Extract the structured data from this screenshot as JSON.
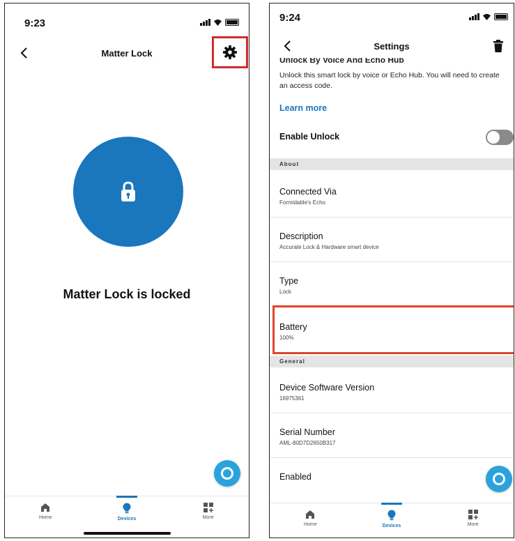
{
  "left": {
    "status_time": "9:23",
    "title": "Matter Lock",
    "lock_status": "Matter Lock is locked",
    "nav": [
      {
        "label": "Home",
        "icon": "home-icon"
      },
      {
        "label": "Devices",
        "icon": "devices-icon",
        "active": true
      },
      {
        "label": "More",
        "icon": "more-icon"
      }
    ]
  },
  "right": {
    "status_time": "9:24",
    "title": "Settings",
    "cut_heading": "Unlock By Voice And Echo Hub",
    "description": "Unlock this smart lock by voice or Echo Hub. You will need to create an access code.",
    "learn_more": "Learn more",
    "enable_unlock_label": "Enable Unlock",
    "enable_unlock_on": false,
    "sections": {
      "about": "About",
      "general": "General"
    },
    "rows": {
      "connected_via": {
        "title": "Connected Via",
        "sub": "Formidable's Echo"
      },
      "description": {
        "title": "Description",
        "sub": "Accurate Lock & Hardware smart device"
      },
      "type": {
        "title": "Type",
        "sub": "Lock"
      },
      "battery": {
        "title": "Battery",
        "sub": "100%"
      },
      "software": {
        "title": "Device Software Version",
        "sub": "16975361"
      },
      "serial": {
        "title": "Serial Number",
        "sub": "AML-80D7D2650B317"
      },
      "enabled": {
        "title": "Enabled"
      }
    },
    "nav": [
      {
        "label": "Home",
        "icon": "home-icon"
      },
      {
        "label": "Devices",
        "icon": "devices-icon",
        "active": true
      },
      {
        "label": "More",
        "icon": "more-icon"
      }
    ]
  },
  "colors": {
    "accent": "#1a76bd",
    "alexa": "#2aa3dd",
    "highlight": "#d52b2b"
  }
}
